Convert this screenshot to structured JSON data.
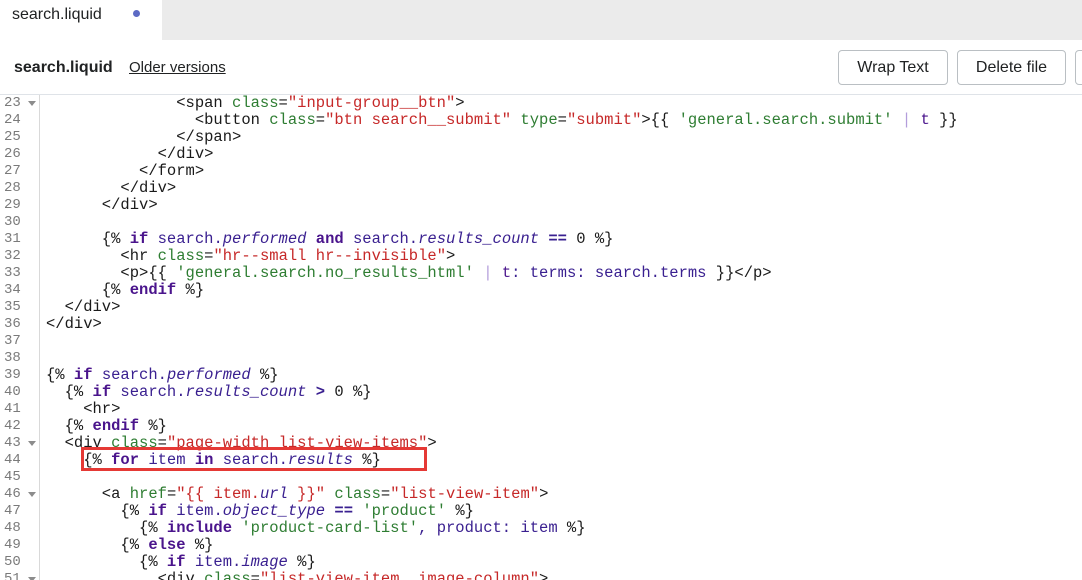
{
  "tab": {
    "label": "search.liquid",
    "unsaved_dot": true
  },
  "filebar": {
    "file_name": "search.liquid",
    "older_versions": "Older versions",
    "wrap_text": "Wrap Text",
    "delete_file": "Delete file"
  },
  "colors": {
    "accent_dot": "#5c6ac4",
    "highlight_border": "#e53935"
  },
  "highlighted_line": 44,
  "code_lines": [
    {
      "n": "23",
      "fold": true,
      "tokens": [
        [
          "tag",
          "              <span "
        ],
        [
          "attr",
          "class"
        ],
        [
          "tag",
          "="
        ],
        [
          "str",
          "\"input-group__btn\""
        ],
        [
          "tag",
          ">"
        ]
      ]
    },
    {
      "n": "24",
      "fold": false,
      "tokens": [
        [
          "tag",
          "                <button "
        ],
        [
          "attr",
          "class"
        ],
        [
          "tag",
          "="
        ],
        [
          "str",
          "\"btn search__submit\""
        ],
        [
          "tag",
          " "
        ],
        [
          "attr",
          "type"
        ],
        [
          "tag",
          "="
        ],
        [
          "str",
          "\"submit\""
        ],
        [
          "tag",
          ">{{ "
        ],
        [
          "lstr",
          "'general.search.submit'"
        ],
        [
          "tag",
          " "
        ],
        [
          "pipe",
          "|"
        ],
        [
          "tag",
          " "
        ],
        [
          "filter",
          "t"
        ],
        [
          "tag",
          " }}"
        ]
      ]
    },
    {
      "n": "25",
      "fold": false,
      "tokens": [
        [
          "tag",
          "              </span>"
        ]
      ]
    },
    {
      "n": "26",
      "fold": false,
      "tokens": [
        [
          "tag",
          "            </div>"
        ]
      ]
    },
    {
      "n": "27",
      "fold": false,
      "tokens": [
        [
          "tag",
          "          </form>"
        ]
      ]
    },
    {
      "n": "28",
      "fold": false,
      "tokens": [
        [
          "tag",
          "        </div>"
        ]
      ]
    },
    {
      "n": "29",
      "fold": false,
      "tokens": [
        [
          "tag",
          "      </div>"
        ]
      ]
    },
    {
      "n": "30",
      "fold": false,
      "tokens": []
    },
    {
      "n": "31",
      "fold": false,
      "tokens": [
        [
          "delim",
          "      {% "
        ],
        [
          "kw",
          "if"
        ],
        [
          "var",
          " search."
        ],
        [
          "prop",
          "performed"
        ],
        [
          "tag",
          " "
        ],
        [
          "kw",
          "and"
        ],
        [
          "var",
          " search."
        ],
        [
          "prop",
          "results_count"
        ],
        [
          "tag",
          " "
        ],
        [
          "op",
          "=="
        ],
        [
          "num",
          " 0"
        ],
        [
          "delim",
          " %}"
        ]
      ]
    },
    {
      "n": "32",
      "fold": false,
      "tokens": [
        [
          "tag",
          "        <hr "
        ],
        [
          "attr",
          "class"
        ],
        [
          "tag",
          "="
        ],
        [
          "str",
          "\"hr--small hr--invisible\""
        ],
        [
          "tag",
          ">"
        ]
      ]
    },
    {
      "n": "33",
      "fold": false,
      "tokens": [
        [
          "tag",
          "        <p>{{ "
        ],
        [
          "lstr",
          "'general.search.no_results_html'"
        ],
        [
          "tag",
          " "
        ],
        [
          "pipe",
          "|"
        ],
        [
          "tag",
          " "
        ],
        [
          "filter",
          "t"
        ],
        [
          "var",
          ": terms: search.terms"
        ],
        [
          "tag",
          " }}</p>"
        ]
      ]
    },
    {
      "n": "34",
      "fold": false,
      "tokens": [
        [
          "delim",
          "      {% "
        ],
        [
          "kw",
          "endif"
        ],
        [
          "delim",
          " %}"
        ]
      ]
    },
    {
      "n": "35",
      "fold": false,
      "tokens": [
        [
          "tag",
          "  </div>"
        ]
      ]
    },
    {
      "n": "36",
      "fold": false,
      "tokens": [
        [
          "tag",
          "</div>"
        ]
      ]
    },
    {
      "n": "37",
      "fold": false,
      "tokens": []
    },
    {
      "n": "38",
      "fold": false,
      "tokens": []
    },
    {
      "n": "39",
      "fold": false,
      "tokens": [
        [
          "delim",
          "{% "
        ],
        [
          "kw",
          "if"
        ],
        [
          "var",
          " search."
        ],
        [
          "prop",
          "performed"
        ],
        [
          "delim",
          " %}"
        ]
      ]
    },
    {
      "n": "40",
      "fold": false,
      "tokens": [
        [
          "delim",
          "  {% "
        ],
        [
          "kw",
          "if"
        ],
        [
          "var",
          " search."
        ],
        [
          "prop",
          "results_count"
        ],
        [
          "tag",
          " "
        ],
        [
          "op",
          ">"
        ],
        [
          "num",
          " 0"
        ],
        [
          "delim",
          " %}"
        ]
      ]
    },
    {
      "n": "41",
      "fold": false,
      "tokens": [
        [
          "tag",
          "    <hr>"
        ]
      ]
    },
    {
      "n": "42",
      "fold": false,
      "tokens": [
        [
          "delim",
          "  {% "
        ],
        [
          "kw",
          "endif"
        ],
        [
          "delim",
          " %}"
        ]
      ]
    },
    {
      "n": "43",
      "fold": true,
      "tokens": [
        [
          "tag",
          "  <div "
        ],
        [
          "attr",
          "class"
        ],
        [
          "tag",
          "="
        ],
        [
          "str",
          "\"page-width list-view-items\""
        ],
        [
          "tag",
          ">"
        ]
      ]
    },
    {
      "n": "44",
      "fold": false,
      "tokens": [
        [
          "delim",
          "    {% "
        ],
        [
          "kw",
          "for"
        ],
        [
          "var",
          " item "
        ],
        [
          "kw",
          "in"
        ],
        [
          "var",
          " search."
        ],
        [
          "prop",
          "results"
        ],
        [
          "delim",
          " %}"
        ]
      ]
    },
    {
      "n": "45",
      "fold": false,
      "tokens": []
    },
    {
      "n": "46",
      "fold": true,
      "tokens": [
        [
          "tag",
          "      <a "
        ],
        [
          "attr",
          "href"
        ],
        [
          "tag",
          "="
        ],
        [
          "str",
          "\"{{ item."
        ],
        [
          "prop",
          "url"
        ],
        [
          "str",
          " }}\""
        ],
        [
          "tag",
          " "
        ],
        [
          "attr",
          "class"
        ],
        [
          "tag",
          "="
        ],
        [
          "str",
          "\"list-view-item\""
        ],
        [
          "tag",
          ">"
        ]
      ]
    },
    {
      "n": "47",
      "fold": false,
      "tokens": [
        [
          "delim",
          "        {% "
        ],
        [
          "kw",
          "if"
        ],
        [
          "var",
          " item."
        ],
        [
          "prop",
          "object_type"
        ],
        [
          "tag",
          " "
        ],
        [
          "op",
          "=="
        ],
        [
          "tag",
          " "
        ],
        [
          "lstr",
          "'product'"
        ],
        [
          "delim",
          " %}"
        ]
      ]
    },
    {
      "n": "48",
      "fold": false,
      "tokens": [
        [
          "delim",
          "          {% "
        ],
        [
          "kw",
          "include"
        ],
        [
          "tag",
          " "
        ],
        [
          "lstr",
          "'product-card-list'"
        ],
        [
          "var",
          ", product: item"
        ],
        [
          "delim",
          " %}"
        ]
      ]
    },
    {
      "n": "49",
      "fold": false,
      "tokens": [
        [
          "delim",
          "        {% "
        ],
        [
          "kw",
          "else"
        ],
        [
          "delim",
          " %}"
        ]
      ]
    },
    {
      "n": "50",
      "fold": false,
      "tokens": [
        [
          "delim",
          "          {% "
        ],
        [
          "kw",
          "if"
        ],
        [
          "var",
          " item."
        ],
        [
          "prop",
          "image"
        ],
        [
          "delim",
          " %}"
        ]
      ]
    },
    {
      "n": "51",
      "fold": true,
      "tokens": [
        [
          "tag",
          "            <div "
        ],
        [
          "attr",
          "class"
        ],
        [
          "tag",
          "="
        ],
        [
          "str",
          "\"list-view-item__image-column\""
        ],
        [
          "tag",
          ">"
        ]
      ]
    }
  ]
}
